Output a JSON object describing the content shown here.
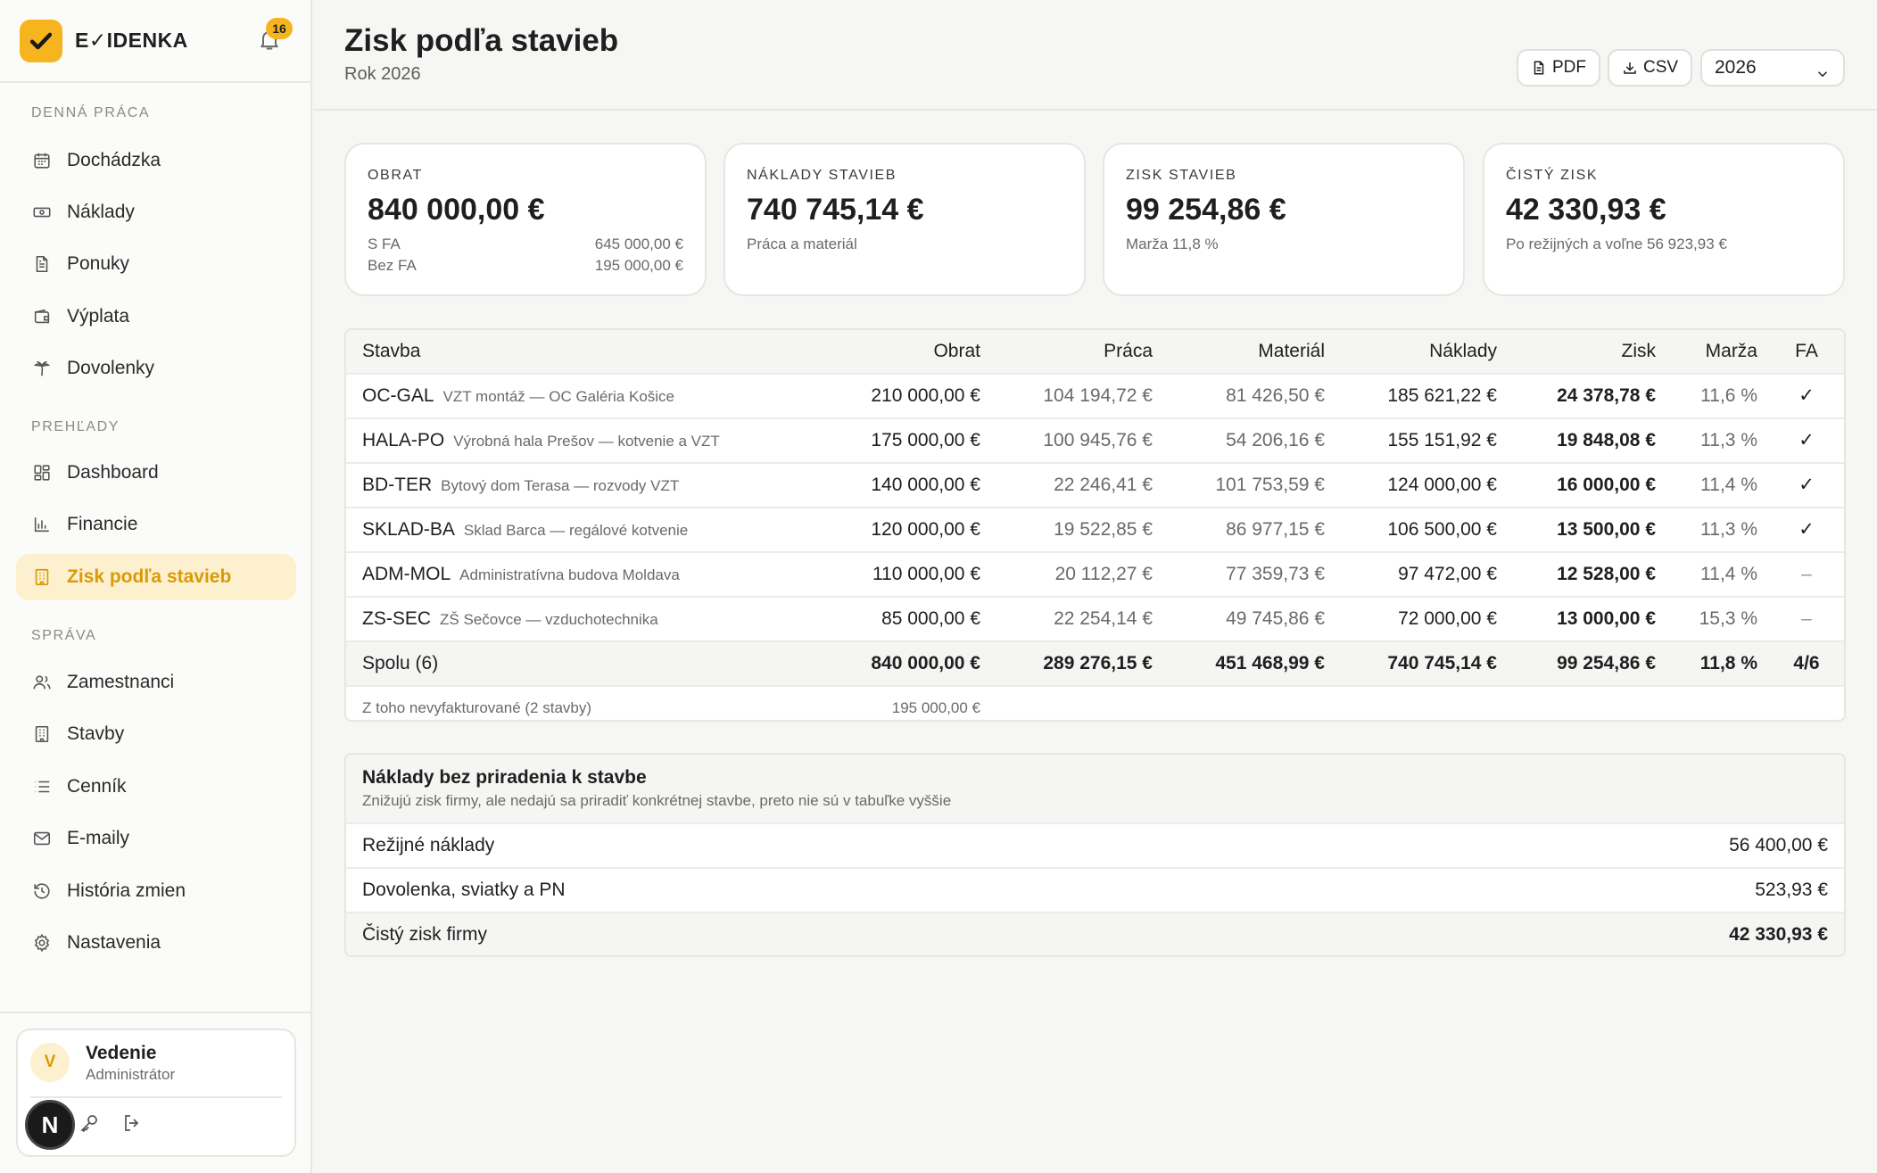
{
  "app": {
    "name": "E✓IDENKA",
    "notification_count": "16"
  },
  "sidebar": {
    "sections": [
      {
        "title": "DENNÁ PRÁCA",
        "items": [
          {
            "label": "Dochádzka",
            "icon": "calendar-icon"
          },
          {
            "label": "Náklady",
            "icon": "banknote-icon"
          },
          {
            "label": "Ponuky",
            "icon": "document-icon"
          },
          {
            "label": "Výplata",
            "icon": "wallet-icon"
          },
          {
            "label": "Dovolenky",
            "icon": "palm-tree-icon"
          }
        ]
      },
      {
        "title": "PREHĽADY",
        "items": [
          {
            "label": "Dashboard",
            "icon": "dashboard-icon"
          },
          {
            "label": "Financie",
            "icon": "bar-chart-icon"
          },
          {
            "label": "Zisk podľa stavieb",
            "icon": "building-icon",
            "active": true
          }
        ]
      },
      {
        "title": "SPRÁVA",
        "items": [
          {
            "label": "Zamestnanci",
            "icon": "users-icon"
          },
          {
            "label": "Stavby",
            "icon": "building-icon"
          },
          {
            "label": "Cenník",
            "icon": "list-icon"
          },
          {
            "label": "E-maily",
            "icon": "mail-icon"
          },
          {
            "label": "História zmien",
            "icon": "history-icon"
          },
          {
            "label": "Nastavenia",
            "icon": "gear-icon"
          }
        ]
      }
    ],
    "user": {
      "initial": "V",
      "name": "Vedenie",
      "role": "Administrátor",
      "badge": "N"
    }
  },
  "header": {
    "title": "Zisk podľa stavieb",
    "subtitle": "Rok 2026",
    "pdf_label": "PDF",
    "csv_label": "CSV",
    "year": "2026"
  },
  "kpis": {
    "obrat": {
      "label": "OBRAT",
      "value": "840 000,00 €",
      "rows": [
        {
          "label": "S FA",
          "value": "645 000,00 €"
        },
        {
          "label": "Bez FA",
          "value": "195 000,00 €"
        }
      ]
    },
    "naklady": {
      "label": "NÁKLADY STAVIEB",
      "value": "740 745,14 €",
      "note": "Práca a materiál"
    },
    "zisk": {
      "label": "ZISK STAVIEB",
      "value": "99 254,86 €",
      "note": "Marža 11,8 %"
    },
    "cisty": {
      "label": "ČISTÝ ZISK",
      "value": "42 330,93 €",
      "note": "Po režijných a voľne 56 923,93 €"
    }
  },
  "table": {
    "headers": {
      "stavba": "Stavba",
      "obrat": "Obrat",
      "praca": "Práca",
      "material": "Materiál",
      "naklady": "Náklady",
      "zisk": "Zisk",
      "marza": "Marža",
      "fa": "FA"
    },
    "rows": [
      {
        "code": "OC-GAL",
        "desc": "VZT montáž — OC Galéria Košice",
        "obrat": "210 000,00 €",
        "praca": "104 194,72 €",
        "material": "81 426,50 €",
        "naklady": "185 621,22 €",
        "zisk": "24 378,78 €",
        "marza": "11,6 %",
        "fa": "✓"
      },
      {
        "code": "HALA-PO",
        "desc": "Výrobná hala Prešov — kotvenie a VZT",
        "obrat": "175 000,00 €",
        "praca": "100 945,76 €",
        "material": "54 206,16 €",
        "naklady": "155 151,92 €",
        "zisk": "19 848,08 €",
        "marza": "11,3 %",
        "fa": "✓"
      },
      {
        "code": "BD-TER",
        "desc": "Bytový dom Terasa — rozvody VZT",
        "obrat": "140 000,00 €",
        "praca": "22 246,41 €",
        "material": "101 753,59 €",
        "naklady": "124 000,00 €",
        "zisk": "16 000,00 €",
        "marza": "11,4 %",
        "fa": "✓"
      },
      {
        "code": "SKLAD-BA",
        "desc": "Sklad Barca — regálové kotvenie",
        "obrat": "120 000,00 €",
        "praca": "19 522,85 €",
        "material": "86 977,15 €",
        "naklady": "106 500,00 €",
        "zisk": "13 500,00 €",
        "marza": "11,3 %",
        "fa": "✓"
      },
      {
        "code": "ADM-MOL",
        "desc": "Administratívna budova Moldava",
        "obrat": "110 000,00 €",
        "praca": "20 112,27 €",
        "material": "77 359,73 €",
        "naklady": "97 472,00 €",
        "zisk": "12 528,00 €",
        "marza": "11,4 %",
        "fa": "–"
      },
      {
        "code": "ZS-SEC",
        "desc": "ZŠ Sečovce — vzduchotechnika",
        "obrat": "85 000,00 €",
        "praca": "22 254,14 €",
        "material": "49 745,86 €",
        "naklady": "72 000,00 €",
        "zisk": "13 000,00 €",
        "marza": "15,3 %",
        "fa": "–"
      }
    ],
    "total": {
      "label": "Spolu (6)",
      "obrat": "840 000,00 €",
      "praca": "289 276,15 €",
      "material": "451 468,99 €",
      "naklady": "740 745,14 €",
      "zisk": "99 254,86 €",
      "marza": "11,8 %",
      "fa": "4/6"
    },
    "note": {
      "label": "Z toho nevyfakturované (2 stavby)",
      "obrat": "195 000,00 €"
    }
  },
  "unassigned": {
    "title": "Náklady bez priradenia k stavbe",
    "subtitle": "Znižujú zisk firmy, ale nedajú sa priradiť konkrétnej stavbe, preto nie sú v tabuľke vyššie",
    "rows": [
      {
        "label": "Režijné náklady",
        "value": "56 400,00 €"
      },
      {
        "label": "Dovolenka, sviatky a PN",
        "value": "523,93 €"
      }
    ],
    "final": {
      "label": "Čistý zisk firmy",
      "value": "42 330,93 €"
    }
  }
}
